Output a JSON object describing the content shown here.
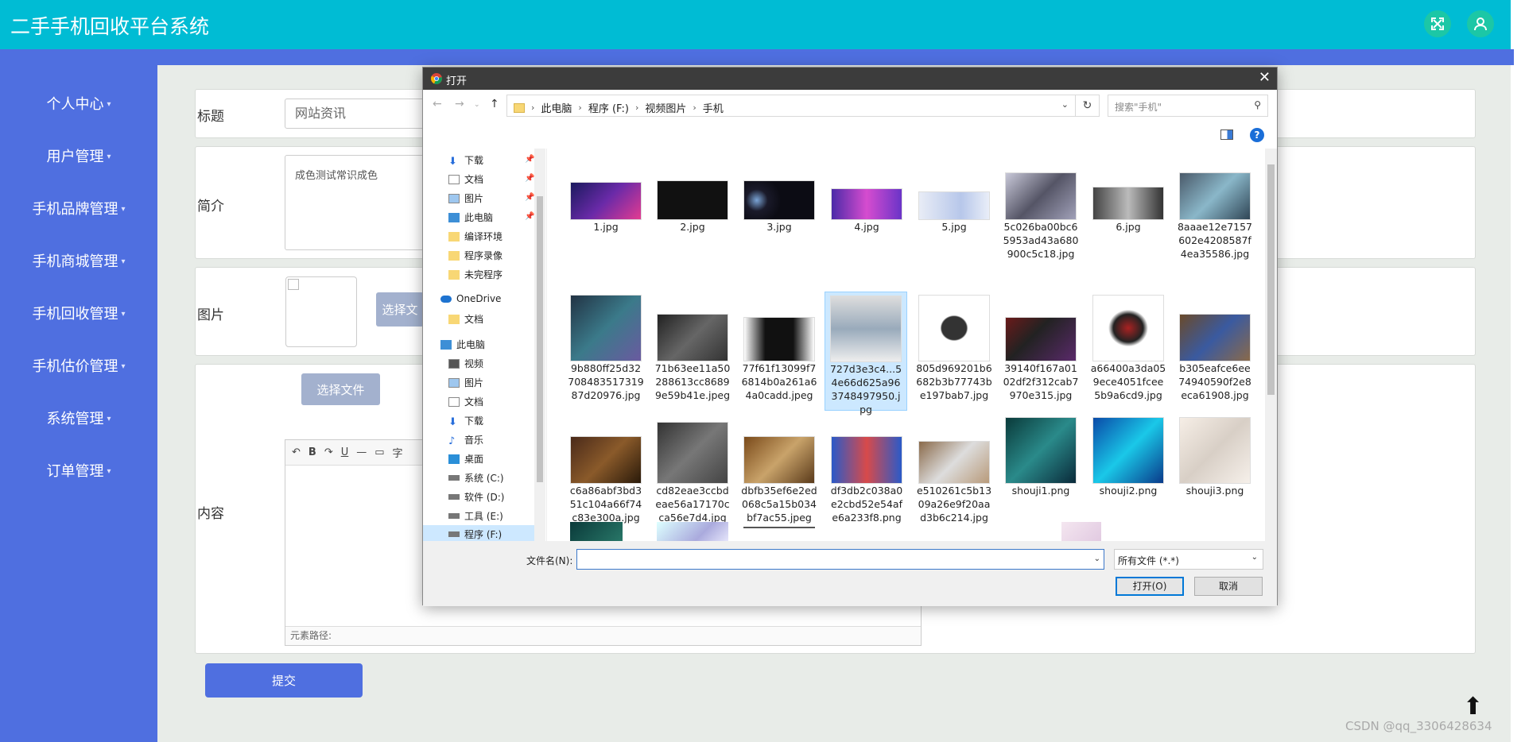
{
  "app": {
    "title": "二手手机回收平台系统"
  },
  "header": {
    "fullscreen_icon": "fullscreen-icon",
    "user_icon": "user-icon"
  },
  "sidebar": {
    "items": [
      {
        "label": "个人中心"
      },
      {
        "label": "用户管理"
      },
      {
        "label": "手机品牌管理"
      },
      {
        "label": "手机商城管理"
      },
      {
        "label": "手机回收管理"
      },
      {
        "label": "手机估价管理"
      },
      {
        "label": "系统管理"
      },
      {
        "label": "订单管理"
      }
    ]
  },
  "form": {
    "title_label": "标题",
    "title_value": "网站资讯",
    "intro_label": "简介",
    "intro_value": "成色测试常识成色",
    "image_label": "图片",
    "choose_file_label": "选择文",
    "content_label": "内容",
    "content_choose_label": "选择文件",
    "editor_toolbar": [
      "↶",
      "B",
      "↷",
      "U",
      "—",
      "▭",
      "字"
    ],
    "editor_path": "元素路径:",
    "submit_label": "提交"
  },
  "watermark": "CSDN @qq_3306428634",
  "dialog": {
    "title": "打开",
    "breadcrumbs": [
      "此电脑",
      "程序 (F:)",
      "视频图片",
      "手机"
    ],
    "search_placeholder": "搜索\"手机\"",
    "nav_items": [
      {
        "label": "下载",
        "pinned": true
      },
      {
        "label": "文档",
        "pinned": true
      },
      {
        "label": "图片",
        "pinned": true
      },
      {
        "label": "此电脑",
        "pinned": true
      },
      {
        "label": "编译环境"
      },
      {
        "label": "程序录像"
      },
      {
        "label": "未完程序"
      },
      {
        "label": "OneDrive"
      },
      {
        "label": "文档"
      },
      {
        "label": "此电脑"
      },
      {
        "label": "视频"
      },
      {
        "label": "图片"
      },
      {
        "label": "文档"
      },
      {
        "label": "下载"
      },
      {
        "label": "音乐"
      },
      {
        "label": "桌面"
      },
      {
        "label": "系统 (C:)"
      },
      {
        "label": "软件 (D:)"
      },
      {
        "label": "工具 (E:)"
      },
      {
        "label": "程序 (F:)"
      }
    ],
    "files": [
      {
        "name": "1.jpg"
      },
      {
        "name": "2.jpg"
      },
      {
        "name": "3.jpg"
      },
      {
        "name": "4.jpg"
      },
      {
        "name": "5.jpg"
      },
      {
        "name": "5c026ba00bc65953ad43a680900c5c18.jpg"
      },
      {
        "name": "6.jpg"
      },
      {
        "name": "8aaae12e7157602e4208587f4ea35586.jpg"
      },
      {
        "name": "9b880ff25d3270848351731987d20976.jpg"
      },
      {
        "name": "71b63ee11a50288613cc86899e59b41e.jpeg"
      },
      {
        "name": "77f61f13099f76814b0a261a64a0cadd.jpeg"
      },
      {
        "name": "727d3e3c4...54e66d625a963748497950.jpg"
      },
      {
        "name": "805d969201b6682b3b77743be197bab7.jpg"
      },
      {
        "name": "39140f167a0102df2f312cab7970e315.jpg"
      },
      {
        "name": "a66400a3da059ece4051fcee5b9a6cd9.jpg"
      },
      {
        "name": "b305eafce6ee74940590f2e8eca61908.jpg"
      },
      {
        "name": "c6a86abf3bd351c104a66f74c83e300a.jpg"
      },
      {
        "name": "cd82eae3ccbdeae56a17170cca56e7d4.jpg"
      },
      {
        "name": "dbfb35ef6e2ed068c5a15b034bf7ac55.jpeg"
      },
      {
        "name": "df3db2c038a0e2cbd52e54afe6a233f8.png"
      },
      {
        "name": "e510261c5b1309a26e9f20aad3b6c214.jpg"
      },
      {
        "name": "shouji1.png"
      },
      {
        "name": "shouji2.png"
      },
      {
        "name": "shouji3.png"
      }
    ],
    "filename_label": "文件名(N):",
    "filetype_value": "所有文件 (*.*)",
    "open_label": "打开(O)",
    "cancel_label": "取消"
  }
}
